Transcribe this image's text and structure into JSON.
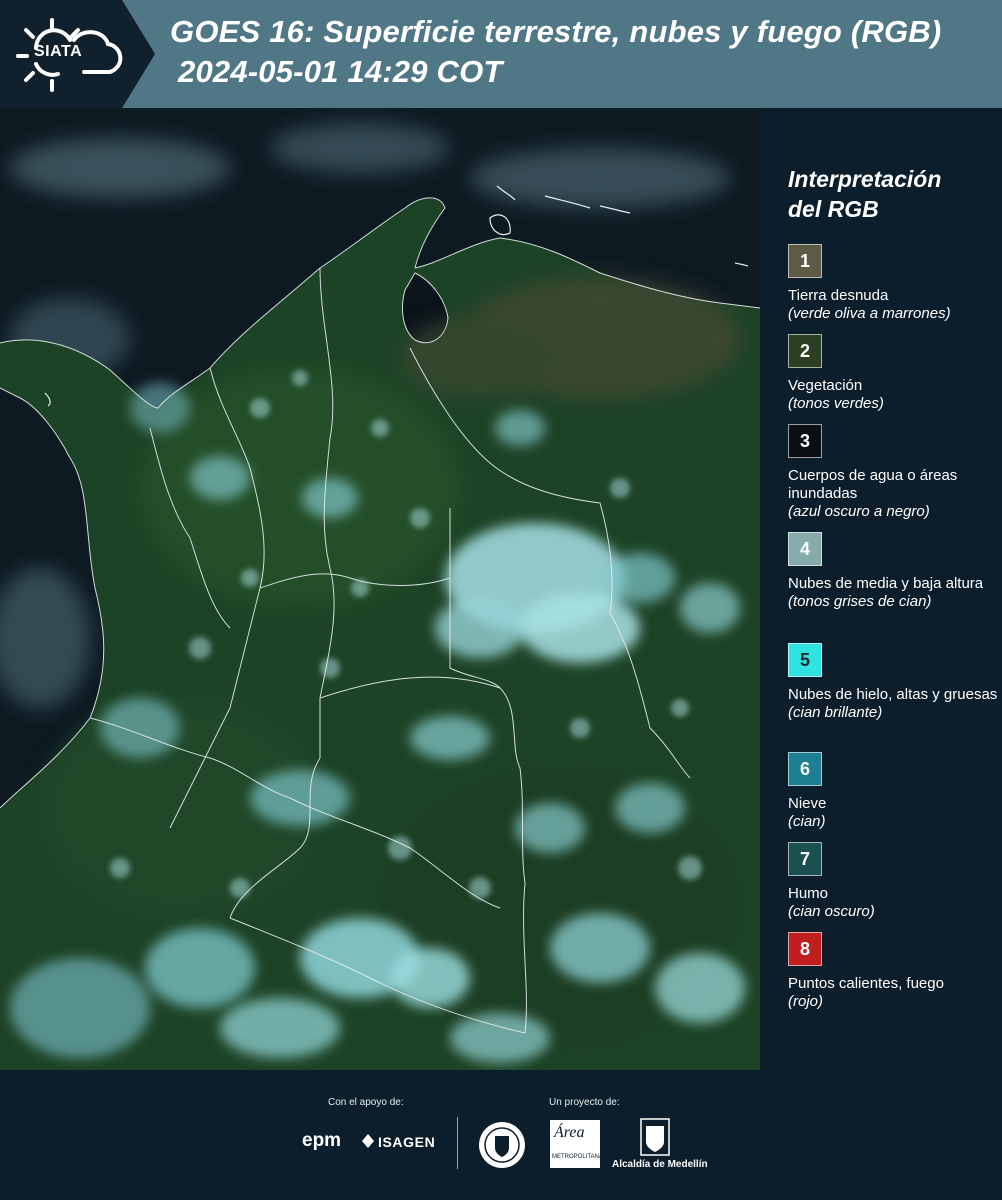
{
  "header": {
    "logo_text": "SIATA",
    "title": "GOES 16: Superficie terrestre, nubes y fuego (RGB)",
    "datetime": "2024-05-01 14:29 COT",
    "colors": {
      "dark": "#10202d",
      "teal": "#4f7785"
    }
  },
  "legend": {
    "title_line1": "Interpretación",
    "title_line2": "del RGB",
    "items": [
      {
        "num": "1",
        "label": "Tierra desnuda",
        "desc": "(verde oliva a marrones)",
        "color": "#5d5a45"
      },
      {
        "num": "2",
        "label": "Vegetación",
        "desc": "(tonos verdes)",
        "color": "#2c3f22"
      },
      {
        "num": "3",
        "label": "Cuerpos de agua o áreas inundadas",
        "desc": "(azul oscuro a negro)",
        "color": "#0b0f13"
      },
      {
        "num": "4",
        "label": "Nubes de media y baja altura",
        "desc": "(tonos grises de cian)",
        "color": "#87abab"
      },
      {
        "num": "5",
        "label": "Nubes de hielo, altas y gruesas",
        "desc": "(cian brillante)",
        "color": "#2fe4e0"
      },
      {
        "num": "6",
        "label": "Nieve",
        "desc": "(cian)",
        "color": "#1e7f93"
      },
      {
        "num": "7",
        "label": "Humo",
        "desc": "(cian oscuro)",
        "color": "#1c4f50"
      },
      {
        "num": "8",
        "label": "Puntos calientes, fuego",
        "desc": "(rojo)",
        "color": "#c01f1f"
      }
    ]
  },
  "footer": {
    "support_label": "Con el apoyo de:",
    "project_label": "Un proyecto de:",
    "epm": "epm",
    "isagen": "ISAGEN",
    "area_text": "Área",
    "area_sub": "METROPOLITANA",
    "alcaldia": "Alcaldía de Medellín"
  }
}
